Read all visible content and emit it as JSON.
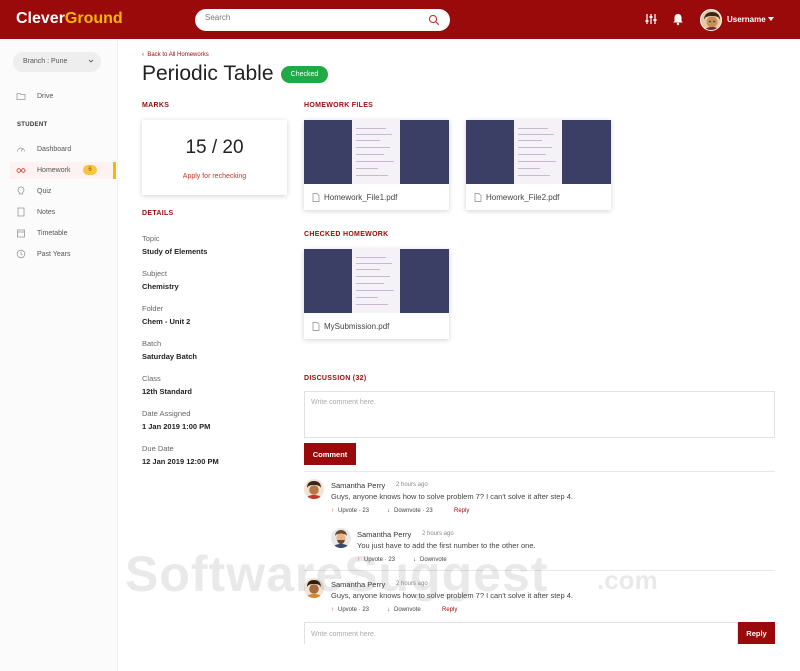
{
  "app": {
    "logo_part1": "Clever",
    "logo_part2": "Ground",
    "search_placeholder": "Search",
    "username": "Username",
    "brand_color": "#9b0a0a",
    "accent_color": "#f5b800"
  },
  "sidebar": {
    "branch": "Branch : Pune",
    "drive": "Drive",
    "section_title": "STUDENT",
    "items": [
      {
        "label": "Dashboard",
        "icon": "dashboard-icon"
      },
      {
        "label": "Homework",
        "icon": "glasses-icon",
        "badge": "6",
        "active": true
      },
      {
        "label": "Quiz",
        "icon": "bulb-icon"
      },
      {
        "label": "Notes",
        "icon": "notes-icon"
      },
      {
        "label": "Timetable",
        "icon": "calendar-icon"
      },
      {
        "label": "Past Years",
        "icon": "clock-icon"
      }
    ]
  },
  "page": {
    "back_link": "Back to All Homeworks",
    "title": "Periodic Table",
    "status": "Checked",
    "status_color": "#22a845"
  },
  "marks": {
    "label": "MARKS",
    "score": "15 / 20",
    "recheck": "Apply for rechecking"
  },
  "details": {
    "label": "DETAILS",
    "fields": [
      {
        "label": "Topic",
        "value": "Study of Elements"
      },
      {
        "label": "Subject",
        "value": "Chemistry"
      },
      {
        "label": "Folder",
        "value": "Chem - Unit 2"
      },
      {
        "label": "Batch",
        "value": "Saturday Batch"
      },
      {
        "label": "Class",
        "value": "12th Standard"
      },
      {
        "label": "Date Assigned",
        "value": "1 Jan 2019 1:00 PM"
      },
      {
        "label": "Due Date",
        "value": "12 Jan 2019 12:00 PM"
      }
    ]
  },
  "homework_files": {
    "label": "HOMEWORK FILES",
    "files": [
      "Homework_File1.pdf",
      "Homework_File2.pdf"
    ]
  },
  "checked_homework": {
    "label": "CHECKED HOMEWORK",
    "files": [
      "MySubmission.pdf"
    ]
  },
  "discussion": {
    "label": "DISCUSSION (32)",
    "placeholder": "Write comment here.",
    "comment_button": "Comment",
    "comments": [
      {
        "name": "Samantha Perry",
        "time": "2 hours ago",
        "text": "Guys, anyone knows how to solve problem 7?  I can't solve it after step 4.",
        "upvote": "Upvote · 23",
        "downvote": "Downvote · 23",
        "reply": "Reply"
      },
      {
        "name": "Samantha Perry",
        "time": "2 hours ago",
        "text": "You just have to add the first number to the other one.",
        "upvote": "Upvote · 23",
        "downvote": "Downvote"
      },
      {
        "name": "Samantha Perry",
        "time": "2 hours ago",
        "text": "Guys, anyone knows how to solve problem 7?  I can't solve it after step 4.",
        "upvote": "Upvote · 23",
        "downvote": "Downvote",
        "reply": "Reply"
      }
    ],
    "reply_placeholder": "Write comment here.",
    "reply_button": "Reply"
  },
  "watermark": {
    "main": "SoftwareSuggest",
    "suffix": ".com"
  }
}
